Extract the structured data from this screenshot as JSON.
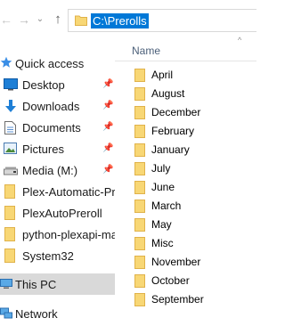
{
  "address_bar": {
    "path": "C:\\Prerolls"
  },
  "nav_buttons": {
    "back": "←",
    "forward": "→",
    "recent": "⌄",
    "up": "↑"
  },
  "navigation_pane": {
    "quick_access": {
      "label": "Quick access",
      "icon": "star-icon"
    },
    "items": [
      {
        "label": "Desktop",
        "icon": "desktop-icon",
        "pinned": true
      },
      {
        "label": "Downloads",
        "icon": "download-arrow-icon",
        "pinned": true
      },
      {
        "label": "Documents",
        "icon": "documents-icon",
        "pinned": true
      },
      {
        "label": "Pictures",
        "icon": "pictures-icon",
        "pinned": true
      },
      {
        "label": "Media (M:)",
        "icon": "drive-icon",
        "pinned": true
      },
      {
        "label": "Plex-Automatic-Pre",
        "icon": "folder-icon",
        "pinned": false
      },
      {
        "label": "PlexAutoPreroll",
        "icon": "folder-icon",
        "pinned": false
      },
      {
        "label": "python-plexapi-ma",
        "icon": "folder-icon",
        "pinned": false
      },
      {
        "label": "System32",
        "icon": "folder-icon",
        "pinned": false
      }
    ],
    "this_pc": {
      "label": "This PC",
      "icon": "computer-icon",
      "selected": true
    },
    "network": {
      "label": "Network",
      "icon": "network-icon"
    }
  },
  "content_pane": {
    "column_header": "Name",
    "sort_indicator": "^",
    "folders": [
      "April",
      "August",
      "December",
      "February",
      "January",
      "July",
      "June",
      "March",
      "May",
      "Misc",
      "November",
      "October",
      "September"
    ]
  },
  "colors": {
    "folder_yellow": "#f8d775",
    "folder_dark": "#e0b24a",
    "selection_blue": "#0078d7",
    "this_pc_bg": "#d9d9d9"
  }
}
